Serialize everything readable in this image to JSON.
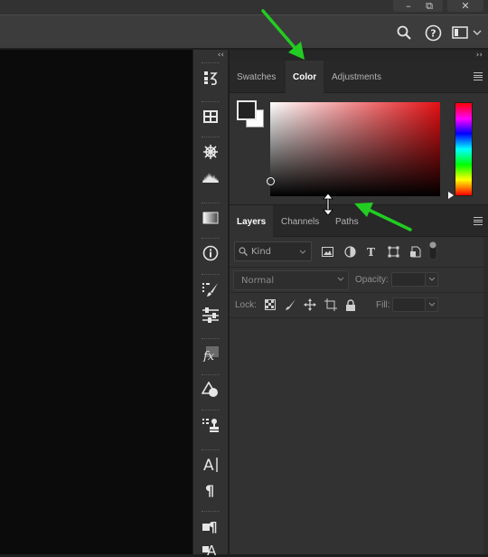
{
  "window": {
    "minimize_glyph": "–",
    "restore_glyph": "⧉",
    "close_glyph": "✕"
  },
  "toolbar": {
    "icons": [
      "search-icon",
      "help-icon",
      "workspace-icon",
      "chevron-down-icon"
    ]
  },
  "toolstrip": {
    "collapse_glyph": "‹‹",
    "groups": [
      [
        "history-icon"
      ],
      [
        "artboard-icon"
      ],
      [
        "navigator-icon",
        "histogram-icon"
      ],
      [
        "gradient-icon"
      ],
      [
        "info-icon"
      ],
      [
        "brush-settings-icon",
        "adjustments-sliders-icon"
      ],
      [
        "styles-fx-icon"
      ],
      [
        "shapes-icon"
      ],
      [
        "clone-source-icon"
      ],
      [
        "character-icon",
        "paragraph-icon"
      ],
      [
        "paragraph-styles-icon",
        "character-styles-icon"
      ]
    ]
  },
  "panels": {
    "collapse_glyph": "››",
    "color_group": {
      "tabs": [
        "Swatches",
        "Color",
        "Adjustments"
      ],
      "active_tab": "Color",
      "colors": {
        "foreground": "#232323",
        "background": "#ffffff",
        "field_hue": "#e41014"
      }
    },
    "layers_group": {
      "tabs": [
        "Layers",
        "Channels",
        "Paths"
      ],
      "active_tab": "Layers",
      "filter_placeholder": "Kind",
      "blend_mode": "Normal",
      "opacity_label": "Opacity:",
      "lock_label": "Lock:",
      "fill_label": "Fill:"
    }
  },
  "annotations": {
    "arrow_color": "#22cc22"
  }
}
